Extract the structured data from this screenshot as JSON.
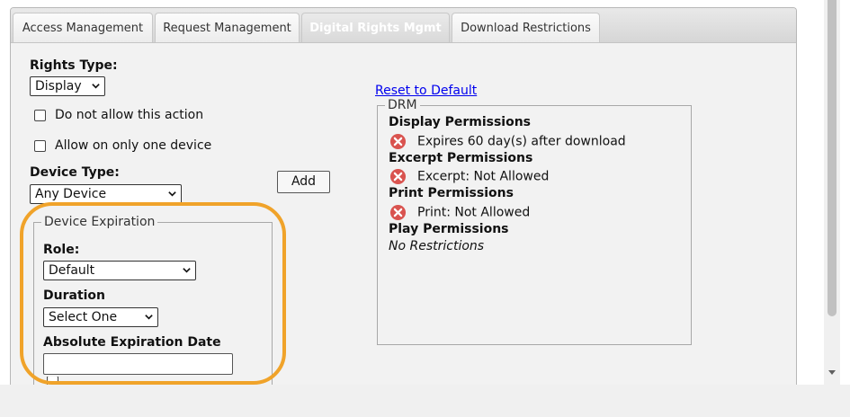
{
  "tabs": [
    {
      "label": "Access Management",
      "active": false
    },
    {
      "label": "Request Management",
      "active": false
    },
    {
      "label": "Digital Rights Mgmt",
      "active": true
    },
    {
      "label": "Download Restrictions",
      "active": false
    }
  ],
  "form": {
    "rights_type": {
      "label": "Rights Type:",
      "value": "Display"
    },
    "checkboxes": {
      "do_not_allow": {
        "label": "Do not allow this action",
        "checked": false
      },
      "one_device": {
        "label": "Allow on only one device",
        "checked": false
      }
    },
    "device_type": {
      "label": "Device Type:",
      "value": "Any Device"
    },
    "add_button": "Add",
    "device_expiration": {
      "legend": "Device Expiration",
      "role": {
        "label": "Role:",
        "value": "Default"
      },
      "duration": {
        "label": "Duration",
        "value": "Select One"
      },
      "absolute_date": {
        "label": "Absolute Expiration Date",
        "value": ""
      }
    }
  },
  "drm": {
    "reset_link": "Reset to Default",
    "legend": "DRM",
    "sections": [
      {
        "title": "Display Permissions",
        "item": "Expires 60 day(s) after download",
        "icon": "error-x-icon"
      },
      {
        "title": "Excerpt Permissions",
        "item": "Excerpt: Not Allowed",
        "icon": "error-x-icon"
      },
      {
        "title": "Print Permissions",
        "item": "Print: Not Allowed",
        "icon": "error-x-icon"
      },
      {
        "title": "Play Permissions",
        "note": "No Restrictions"
      }
    ]
  },
  "colors": {
    "highlight": "#f0a32a",
    "error_icon": "#d9534f",
    "link": "#0000ee"
  }
}
